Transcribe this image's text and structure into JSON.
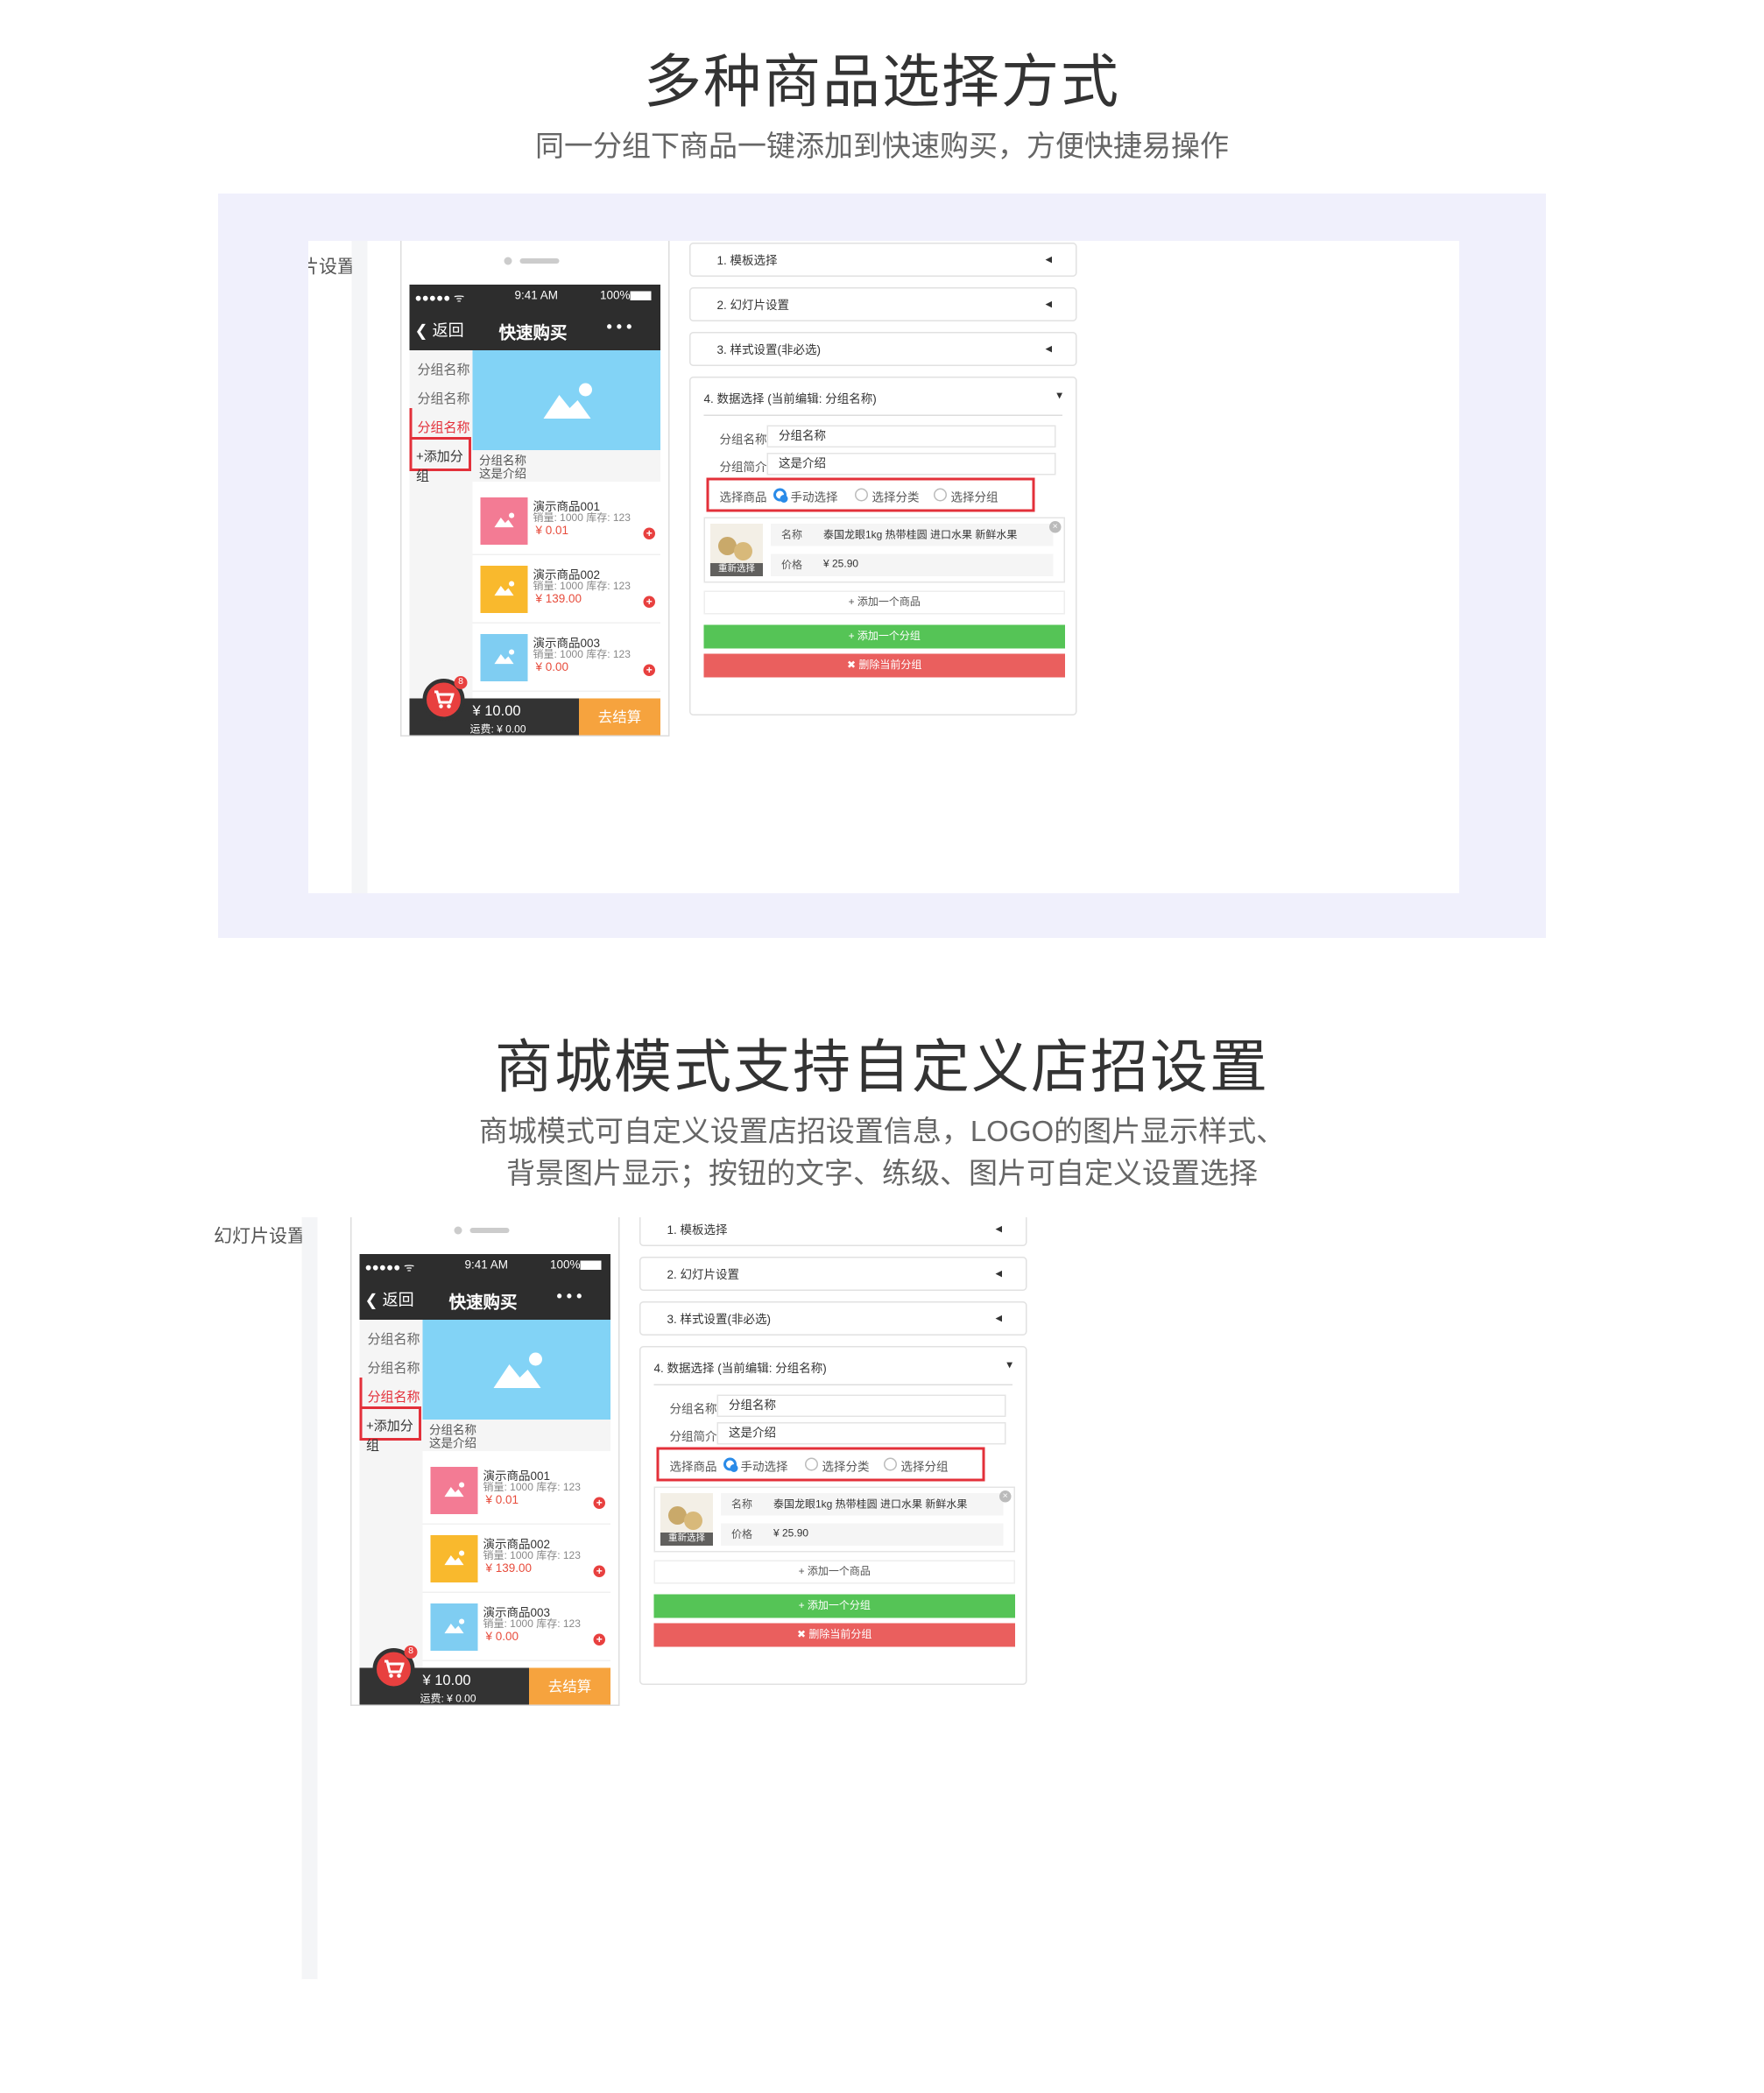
{
  "section1": {
    "title": "多种商品选择方式",
    "subtitle": "同一分组下商品一键添加到快速购买，方便快捷易操作"
  },
  "section2": {
    "title": "商城模式支持自定义店招设置",
    "subtitle_line1": "商城模式可自定义设置店招设置信息，LOGO的图片显示样式、",
    "subtitle_line2": "背景图片显示；按钮的文字、练级、图片可自定义设置选择"
  },
  "screen": {
    "sidebar_title": "幻灯片设置",
    "status": {
      "signal": "●●●●● ᯤ",
      "time": "9:41 AM",
      "battery": "100%"
    },
    "nav": {
      "back": "返回",
      "title": "快速购买",
      "more": "• • •"
    },
    "groups": [
      "分组名称",
      "分组名称",
      "分组名称"
    ],
    "add_group": "+添加分组",
    "group_info": {
      "name": "分组名称",
      "intro": "这是介绍"
    },
    "products": [
      {
        "name": "演示商品001",
        "meta": "销量: 1000 库存: 123",
        "price": "¥ 0.01",
        "color": "#f37b94"
      },
      {
        "name": "演示商品002",
        "meta": "销量: 1000 库存: 123",
        "price": "¥ 139.00",
        "color": "#f9b92d"
      },
      {
        "name": "演示商品003",
        "meta": "销量: 1000 库存: 123",
        "price": "¥ 0.00",
        "color": "#7fcdf2"
      }
    ],
    "banner_color": "#82d3f6",
    "cart": {
      "badge": "8",
      "total": "¥ 10.00",
      "shipping": "运费: ¥ 0.00",
      "checkout": "去结算"
    },
    "panels": [
      {
        "label": "1. 模板选择"
      },
      {
        "label": "2. 幻灯片设置"
      },
      {
        "label": "3. 样式设置(非必选)"
      },
      {
        "label": "4. 数据选择 (当前编辑: 分组名称)"
      }
    ],
    "form": {
      "name_label": "分组名称",
      "name_value": "分组名称",
      "intro_label": "分组简介",
      "intro_value": "这是介绍",
      "select_label": "选择商品",
      "options": [
        "手动选择",
        "选择分类",
        "选择分组"
      ],
      "selected_option": "手动选择"
    },
    "product_card": {
      "reselect": "重新选择",
      "name_label": "名称",
      "name_value": "泰国龙眼1kg 热带桂圆 进口水果 新鲜水果",
      "price_label": "价格",
      "price_value": "¥ 25.90"
    },
    "add_product": "+ 添加一个商品",
    "add_group_btn": "+ 添加一个分组",
    "delete_group_btn": "✖ 删除当前分组",
    "colors": {
      "accent_red": "#e3303a",
      "green": "#55c456",
      "red_btn": "#ea5f5e",
      "orange": "#f6a33e",
      "radio_blue": "#2a8be8"
    }
  }
}
